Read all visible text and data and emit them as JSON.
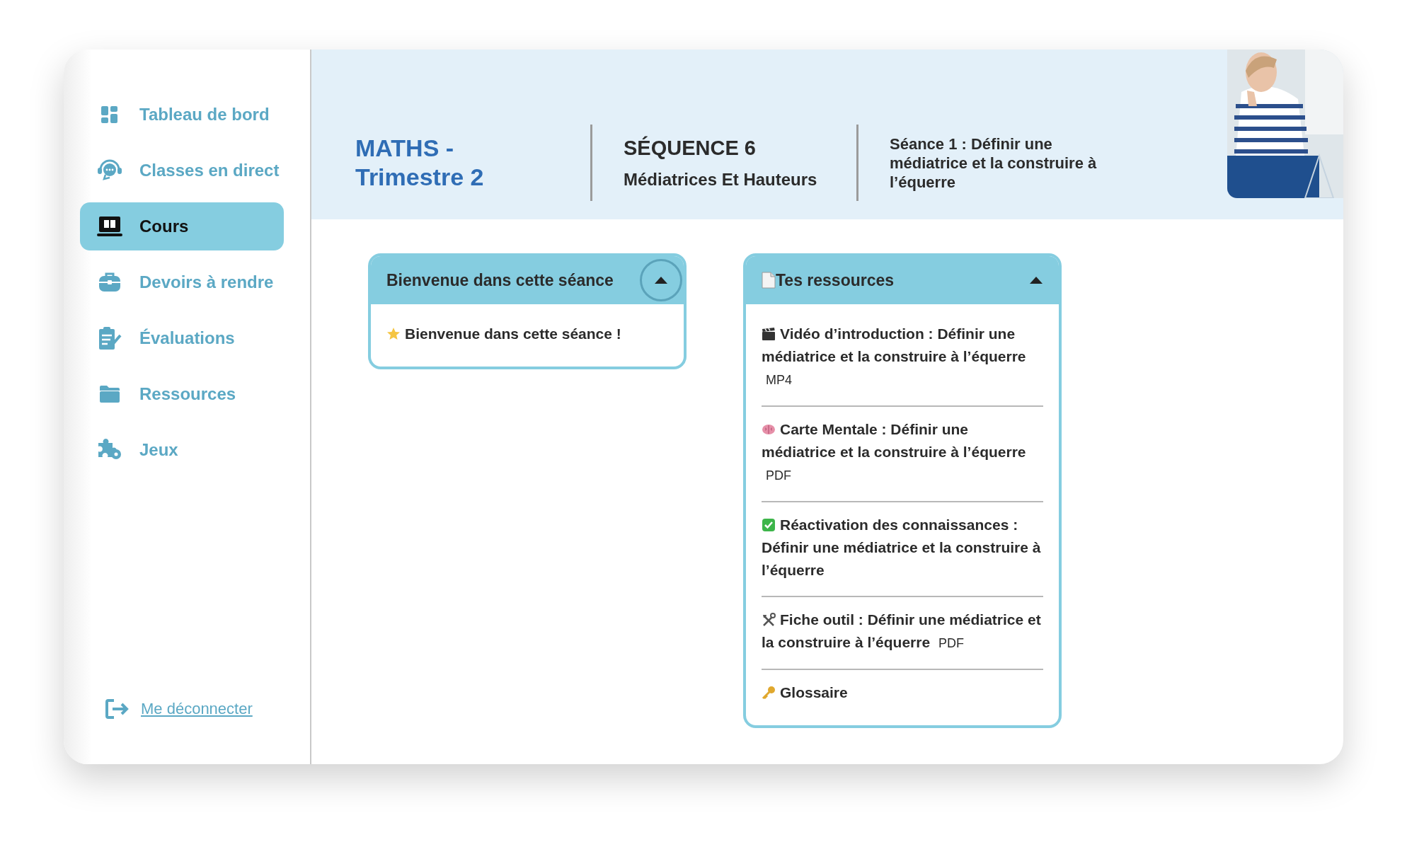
{
  "sidebar": {
    "items": [
      {
        "label": "Tableau de bord",
        "selected": false
      },
      {
        "label": "Classes en direct",
        "selected": false
      },
      {
        "label": "Cours",
        "selected": true
      },
      {
        "label": "Devoirs à rendre",
        "selected": false
      },
      {
        "label": "Évaluations",
        "selected": false
      },
      {
        "label": "Ressources",
        "selected": false
      },
      {
        "label": "Jeux",
        "selected": false
      }
    ],
    "logout": "Me déconnecter"
  },
  "header": {
    "subject": "MATHS - Trimestre 2",
    "sequence": "SÉQUENCE 6",
    "sequence_title": "Médiatrices Et Hauteurs",
    "session": "Séance 1 : Définir une médiatrice et la construire à l’équerre"
  },
  "cards": [
    {
      "title": "Bienvenue dans cette séance",
      "expanded": true,
      "items": [
        {
          "kind": "star",
          "text": "Bienvenue dans cette séance !"
        }
      ]
    },
    {
      "title": "Tes ressources",
      "expanded": true,
      "items": [
        {
          "kind": "video",
          "text": "Vidéo d’introduction : Définir une médiatrice et la construire à l’équerre",
          "format": "MP4"
        },
        {
          "kind": "brain",
          "text": "Carte Mentale : Définir une médiatrice et la construire à l’équerre",
          "format": "PDF"
        },
        {
          "kind": "check",
          "text": "Réactivation des connaissances : Définir une médiatrice et la construire à l’équerre"
        },
        {
          "kind": "tools",
          "text": "Fiche outil : Définir une médiatrice et la construire à l’équerre",
          "format": "PDF"
        },
        {
          "kind": "key",
          "text": "Glossaire"
        }
      ]
    }
  ]
}
